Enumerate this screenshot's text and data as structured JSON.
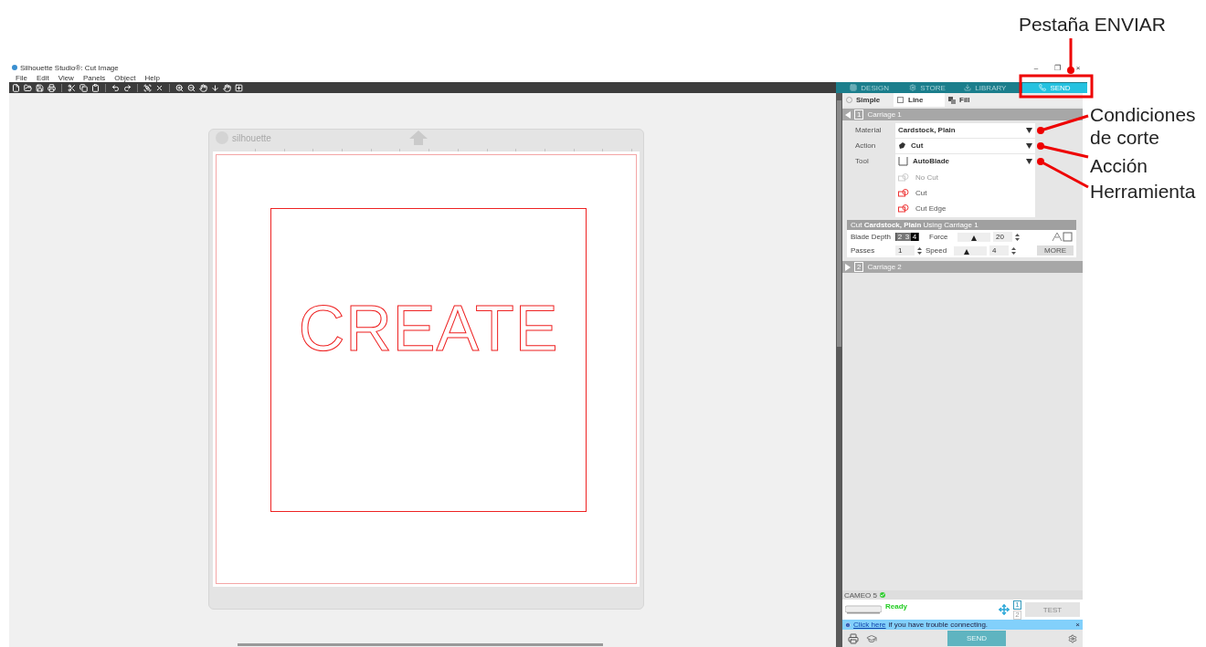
{
  "callouts": [
    {
      "label": "Pestaña ENVIAR"
    },
    {
      "label": "Condiciones de corte"
    },
    {
      "label": "Acción"
    },
    {
      "label": "Herramienta"
    }
  ],
  "window": {
    "title": "Silhouette Studio®: Cut Image",
    "controls": [
      "–",
      "❐",
      "×"
    ]
  },
  "menu": [
    "File",
    "Edit",
    "View",
    "Panels",
    "Object",
    "Help"
  ],
  "tabs": [
    {
      "label": "DESIGN",
      "selected": false
    },
    {
      "label": "STORE",
      "selected": false
    },
    {
      "label": "LIBRARY",
      "selected": false
    },
    {
      "label": "SEND",
      "selected": true
    }
  ],
  "modes": [
    {
      "label": "Simple",
      "kind": "radio",
      "selected": false
    },
    {
      "label": "Line",
      "kind": "line",
      "selected": true
    },
    {
      "label": "Fill",
      "kind": "fill",
      "selected": false
    }
  ],
  "mat": {
    "brand": "silhouette"
  },
  "design": {
    "text": "CREATE"
  },
  "carriages": [
    {
      "number": "1",
      "label": "Carriage 1",
      "expanded": true
    },
    {
      "number": "2",
      "label": "Carriage 2",
      "expanded": false
    }
  ],
  "settings": [
    {
      "label": "Material",
      "value": "Cardstock, Plain",
      "kind": "material"
    },
    {
      "label": "Action",
      "value": "Cut",
      "kind": "action"
    },
    {
      "label": "Tool",
      "value": "AutoBlade",
      "kind": "tool"
    }
  ],
  "actions": [
    {
      "label": "No Cut",
      "disabled": true
    },
    {
      "label": "Cut",
      "disabled": false
    },
    {
      "label": "Cut Edge",
      "disabled": false
    }
  ],
  "cut_header": "Cut **Cardstock, Plain** Using Carriage 1",
  "blade_depth": {
    "label": "Blade Depth",
    "digits": [
      {
        "label": "2",
        "selected": false
      },
      {
        "label": "3",
        "selected": false
      },
      {
        "label": "4",
        "selected": true
      }
    ]
  },
  "force": {
    "label": "Force",
    "value": "20",
    "level": 0.5
  },
  "passes": {
    "label": "Passes",
    "value": "1"
  },
  "speed": {
    "label": "Speed",
    "value": "4",
    "level": 0.4
  },
  "more": "MORE",
  "machine": {
    "name": "CAMEO 5",
    "connected": true,
    "status": "Ready"
  },
  "tool_slots": [
    {
      "label": "1",
      "selected": true
    },
    {
      "label": "2",
      "selected": false
    }
  ],
  "test": "TEST",
  "help": {
    "link": "Click here",
    "text": "if you have trouble connecting.",
    "close": "×"
  },
  "send": "SEND"
}
